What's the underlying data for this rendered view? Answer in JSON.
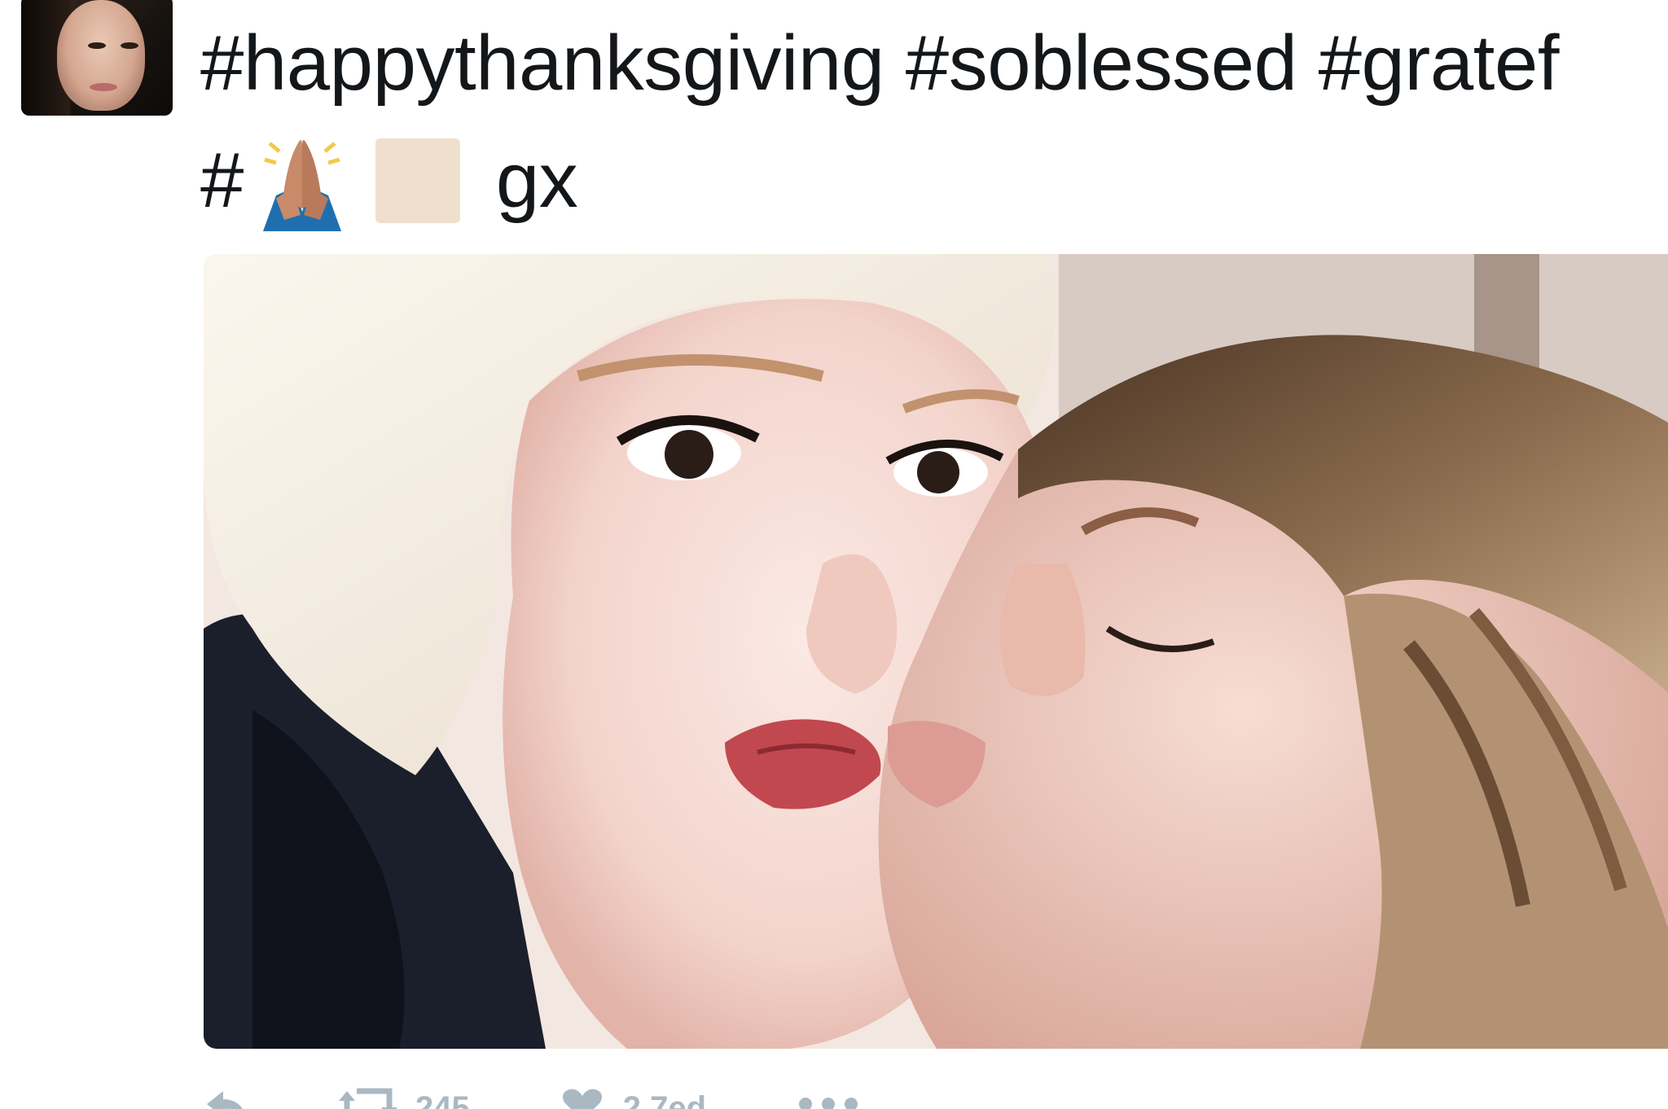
{
  "tweet": {
    "text_line1": "#happythanksgiving #soblessed #gratef",
    "text_hash": "#",
    "text_tail": "gx",
    "emoji_1": "folded-hands-icon",
    "emoji_2": "skin-tone-modifier-icon"
  },
  "actions": {
    "reply_icon": "reply-icon",
    "retweet_icon": "retweet-icon",
    "retweet_count": "245",
    "like_icon": "heart-icon",
    "like_count": "2,7ed",
    "more_icon": "more-icon"
  },
  "colors": {
    "text": "#14171a",
    "muted": "#aab8c2",
    "swatch": "#efe0cd"
  }
}
